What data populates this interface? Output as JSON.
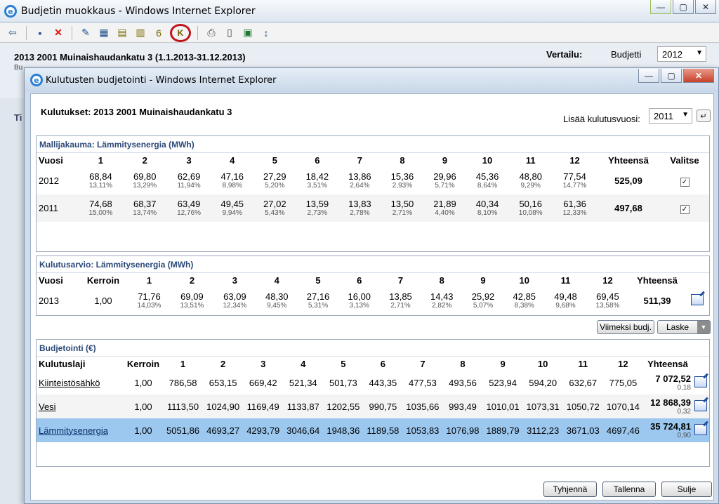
{
  "outer": {
    "title": "Budjetin muokkaus - Windows Internet Explorer",
    "header": "2013  2001 Muinaishaudankatu 3  (1.1.2013-31.12.2013)",
    "header_sub": "Bu",
    "tab_hint": "Ti",
    "vertailu_label": "Vertailu:",
    "vertailu_type": "Budjetti",
    "vertailu_year": "2012",
    "toolbar_icons": [
      "back-arrow-icon",
      "save-icon",
      "delete-icon",
      "edit-form-icon",
      "grid-icon",
      "calc-icon",
      "calc-add-icon",
      "calc-6-icon",
      "calc-circled-icon",
      "print-icon",
      "document-icon",
      "excel-icon",
      "expand-vertical-icon"
    ]
  },
  "modal": {
    "title": "Kulutusten budjetointi - Windows Internet Explorer",
    "kulutukset": "Kulutukset: 2013  2001 Muinaishaudankatu 3",
    "lisaa_label": "Lisää kulutusvuosi:",
    "lisaa_year": "2011",
    "enter_symbol": "↵"
  },
  "panel1": {
    "title": "Mallijakauma: Lämmitysenergia (MWh)",
    "headers": [
      "Vuosi",
      "1",
      "2",
      "3",
      "4",
      "5",
      "6",
      "7",
      "8",
      "9",
      "10",
      "11",
      "12",
      "Yhteensä",
      "Valitse"
    ],
    "rows": [
      {
        "year": "2012",
        "values": [
          "68,84",
          "69,80",
          "62,69",
          "47,16",
          "27,29",
          "18,42",
          "13,86",
          "15,36",
          "29,96",
          "45,36",
          "48,80",
          "77,54"
        ],
        "pcts": [
          "13,11%",
          "13,29%",
          "11,94%",
          "8,98%",
          "5,20%",
          "3,51%",
          "2,64%",
          "2,93%",
          "5,71%",
          "8,64%",
          "9,29%",
          "14,77%"
        ],
        "total": "525,09",
        "check": "✓"
      },
      {
        "year": "2011",
        "values": [
          "74,68",
          "68,37",
          "63,49",
          "49,45",
          "27,02",
          "13,59",
          "13,83",
          "13,50",
          "21,89",
          "40,34",
          "50,16",
          "61,36"
        ],
        "pcts": [
          "15,00%",
          "13,74%",
          "12,76%",
          "9,94%",
          "5,43%",
          "2,73%",
          "2,78%",
          "2,71%",
          "4,40%",
          "8,10%",
          "10,08%",
          "12,33%"
        ],
        "total": "497,68",
        "check": "✓"
      }
    ]
  },
  "panel2": {
    "title": "Kulutusarvio: Lämmitysenergia (MWh)",
    "headers": [
      "Vuosi",
      "Kerroin",
      "1",
      "2",
      "3",
      "4",
      "5",
      "6",
      "7",
      "8",
      "9",
      "10",
      "11",
      "12",
      "Yhteensä"
    ],
    "rows": [
      {
        "year": "2013",
        "kerroin": "1,00",
        "values": [
          "71,76",
          "69,09",
          "63,09",
          "48,30",
          "27,16",
          "16,00",
          "13,85",
          "14,43",
          "25,92",
          "42,85",
          "49,48",
          "69,45"
        ],
        "pcts": [
          "14,03%",
          "13,51%",
          "12,34%",
          "9,45%",
          "5,31%",
          "3,13%",
          "2,71%",
          "2,82%",
          "5,07%",
          "8,38%",
          "9,68%",
          "13,58%"
        ],
        "total": "511,39"
      }
    ]
  },
  "mid_buttons": {
    "viimeksi": "Viimeksi budj.",
    "laske": "Laske"
  },
  "panel3": {
    "title": "Budjetointi (€)",
    "headers": [
      "Kulutuslaji",
      "Kerroin",
      "1",
      "2",
      "3",
      "4",
      "5",
      "6",
      "7",
      "8",
      "9",
      "10",
      "11",
      "12",
      "Yhteensä"
    ],
    "rows": [
      {
        "name": "Kiinteistösähkö",
        "kerroin": "1,00",
        "values": [
          "786,58",
          "653,15",
          "669,42",
          "521,34",
          "501,73",
          "443,35",
          "477,53",
          "493,56",
          "523,94",
          "594,20",
          "632,67",
          "775,05"
        ],
        "total": "7 072,52",
        "sub": "0,18"
      },
      {
        "name": "Vesi",
        "kerroin": "1,00",
        "values": [
          "1113,50",
          "1024,90",
          "1169,49",
          "1133,87",
          "1202,55",
          "990,75",
          "1035,66",
          "993,49",
          "1010,01",
          "1073,31",
          "1050,72",
          "1070,14"
        ],
        "total": "12 868,39",
        "sub": "0,32"
      },
      {
        "name": "Lämmitysenergia",
        "kerroin": "1,00",
        "values": [
          "5051,86",
          "4693,27",
          "4293,79",
          "3046,64",
          "1948,36",
          "1189,58",
          "1053,83",
          "1076,98",
          "1889,79",
          "3112,23",
          "3671,03",
          "4697,46"
        ],
        "total": "35 724,81",
        "sub": "0,90"
      }
    ]
  },
  "bottom_buttons": {
    "tyhjenna": "Tyhjennä",
    "tallenna": "Tallenna",
    "sulje": "Sulje"
  }
}
